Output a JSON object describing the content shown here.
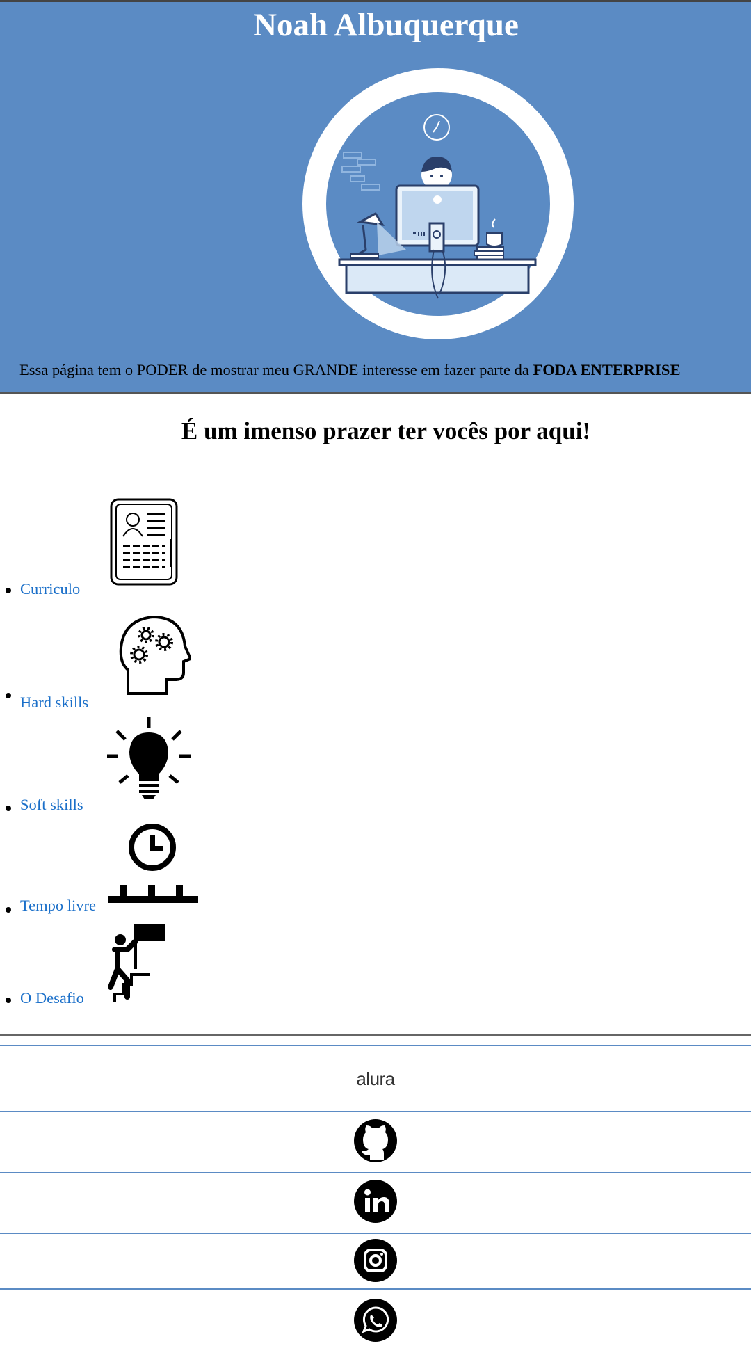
{
  "header": {
    "title": "Noah Albuquerque",
    "tagline_prefix": "Essa página tem o PODER de mostrar meu GRANDE interesse em fazer parte da ",
    "tagline_bold": "FODA ENTERPRISE",
    "background": "#5b8bc4"
  },
  "main": {
    "welcome": "É um imenso prazer ter vocês por aqui!",
    "menu": [
      {
        "label": "Curriculo",
        "icon": "resume-icon"
      },
      {
        "label": "Hard skills",
        "icon": "head-gears-icon"
      },
      {
        "label": "Soft skills",
        "icon": "lightbulb-icon"
      },
      {
        "label": "Tempo livre",
        "icon": "clock-icon"
      },
      {
        "label": "O Desafio",
        "icon": "climber-flag-icon"
      }
    ],
    "link_color": "#1a6fc9"
  },
  "footer": {
    "brand": "alura",
    "social": [
      "github-icon",
      "linkedin-icon",
      "instagram-icon",
      "whatsapp-icon"
    ],
    "rule_color": "#5b8bc4"
  }
}
